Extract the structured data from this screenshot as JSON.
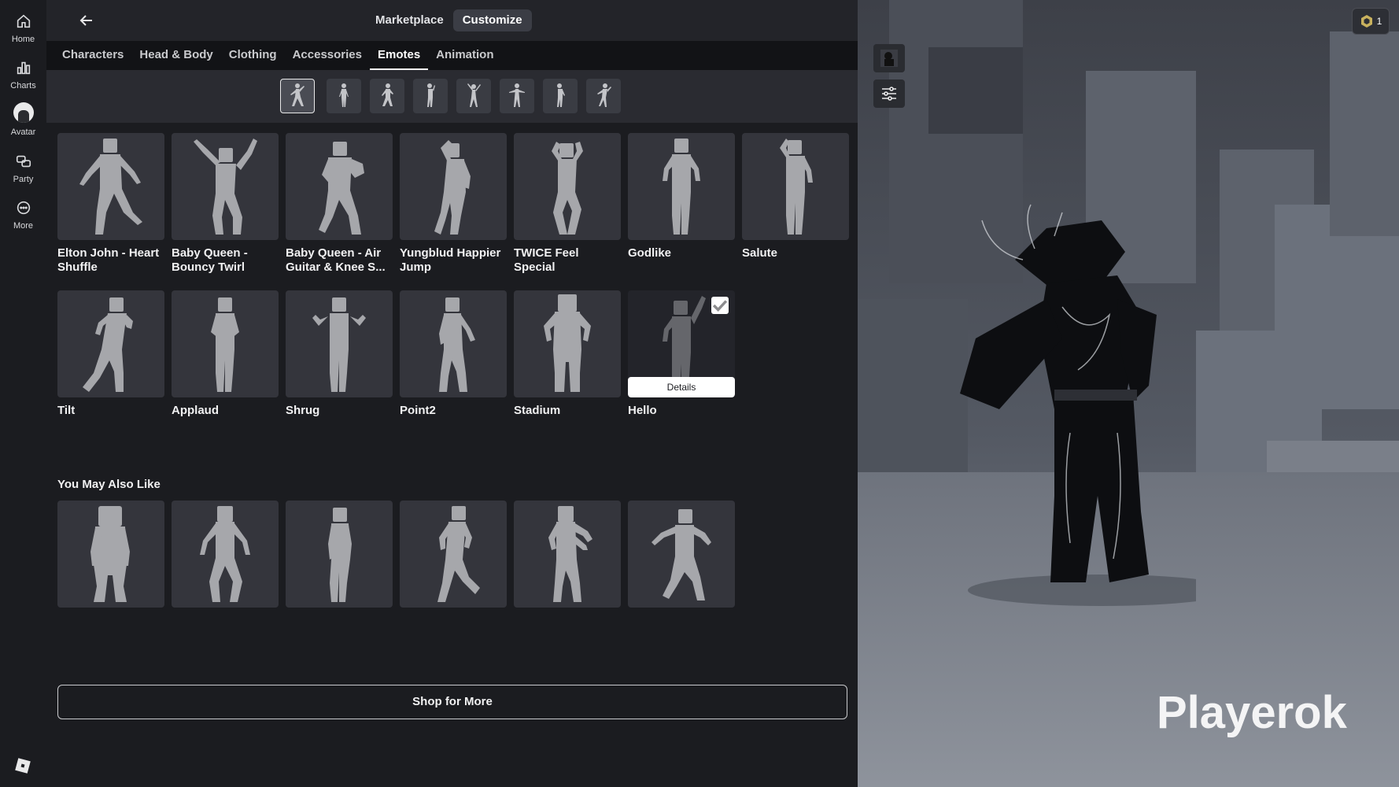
{
  "nav": {
    "items": [
      {
        "label": "Home",
        "icon": "home-icon"
      },
      {
        "label": "Charts",
        "icon": "charts-icon"
      },
      {
        "label": "Avatar",
        "icon": "avatar-icon"
      },
      {
        "label": "Party",
        "icon": "party-icon"
      },
      {
        "label": "More",
        "icon": "more-icon"
      }
    ]
  },
  "topbar": {
    "segments": [
      "Marketplace",
      "Customize"
    ],
    "active_segment": "Customize"
  },
  "tabs": [
    "Characters",
    "Head & Body",
    "Clothing",
    "Accessories",
    "Emotes",
    "Animation"
  ],
  "active_tab": "Emotes",
  "emotes": [
    {
      "name": "Elton John - Heart Shuffle"
    },
    {
      "name": "Baby Queen - Bouncy Twirl"
    },
    {
      "name": "Baby Queen - Air Guitar & Knee S..."
    },
    {
      "name": "Yungblud Happier Jump"
    },
    {
      "name": "TWICE Feel Special"
    },
    {
      "name": "Godlike"
    },
    {
      "name": "Salute"
    },
    {
      "name": "Tilt"
    },
    {
      "name": "Applaud"
    },
    {
      "name": "Shrug"
    },
    {
      "name": "Point2"
    },
    {
      "name": "Stadium"
    },
    {
      "name": "Hello",
      "selected": true,
      "details_label": "Details"
    }
  ],
  "recommendations": {
    "title": "You May Also Like",
    "count_tiles": 6
  },
  "shop_button": "Shop for More",
  "preview": {
    "player_name": "Playerok",
    "robux_count": "1"
  },
  "colors": {
    "background": "#1b1c20",
    "tile": "#34353c",
    "accent_white": "#ffffff"
  }
}
